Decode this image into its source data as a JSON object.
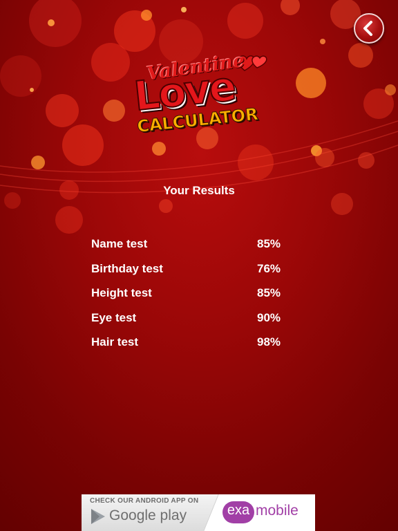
{
  "header": {
    "back_icon": "chevron-left-icon"
  },
  "logo": {
    "line1": "Valentine",
    "line2": "Love",
    "line3": "CALCULATOR",
    "decoration_icon": "hearts-icon"
  },
  "results": {
    "title": "Your Results",
    "rows": [
      {
        "label": "Name test",
        "value": "85%"
      },
      {
        "label": "Birthday test",
        "value": "76%"
      },
      {
        "label": "Height test",
        "value": "85%"
      },
      {
        "label": "Eye test",
        "value": "90%"
      },
      {
        "label": "Hair test",
        "value": "98%"
      }
    ]
  },
  "ad": {
    "check_text": "CHECK OUR ANDROID APP ON",
    "store_name": "Google play",
    "store_icon": "play-triangle-icon",
    "brand_prefix": "exa",
    "brand_suffix": "mobile"
  },
  "colors": {
    "background": "#9a0707",
    "text": "#ffffff",
    "logo_red": "#e4161b",
    "logo_gold": "#ffb000",
    "brand_purple": "#a13fa6"
  }
}
